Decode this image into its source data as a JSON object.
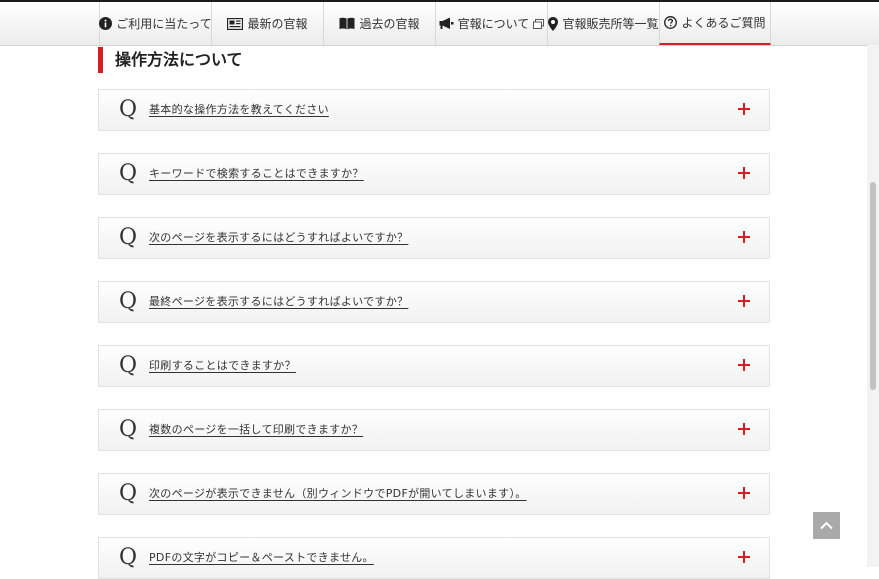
{
  "nav": {
    "items": [
      {
        "label": "ご利用に当たって",
        "icon": "info-icon"
      },
      {
        "label": "最新の官報",
        "icon": "newspaper-icon"
      },
      {
        "label": "過去の官報",
        "icon": "book-icon"
      },
      {
        "label": "官報について",
        "icon": "megaphone-icon",
        "external_icon": "external-window-icon"
      },
      {
        "label": "官報販売所等一覧",
        "icon": "map-pin-icon"
      },
      {
        "label": "よくあるご質問",
        "icon": "question-circle-icon",
        "active": true
      }
    ]
  },
  "section": {
    "title": "操作方法について"
  },
  "faq": {
    "q_mark": "Q",
    "items": [
      {
        "question": "基本的な操作方法を教えてください"
      },
      {
        "question": "キーワードで検索することはできますか？"
      },
      {
        "question": "次のページを表示するにはどうすればよいですか？"
      },
      {
        "question": "最終ページを表示するにはどうすればよいですか？"
      },
      {
        "question": "印刷することはできますか？"
      },
      {
        "question": "複数のページを一括して印刷できますか？"
      },
      {
        "question": "次のページが表示できません（別ウィンドウでPDFが開いてしまいます）。"
      },
      {
        "question": "PDFの文字がコピー＆ペーストできません。"
      }
    ]
  },
  "colors": {
    "accent": "#d61d23",
    "back_to_top": "#a9a9a9"
  }
}
